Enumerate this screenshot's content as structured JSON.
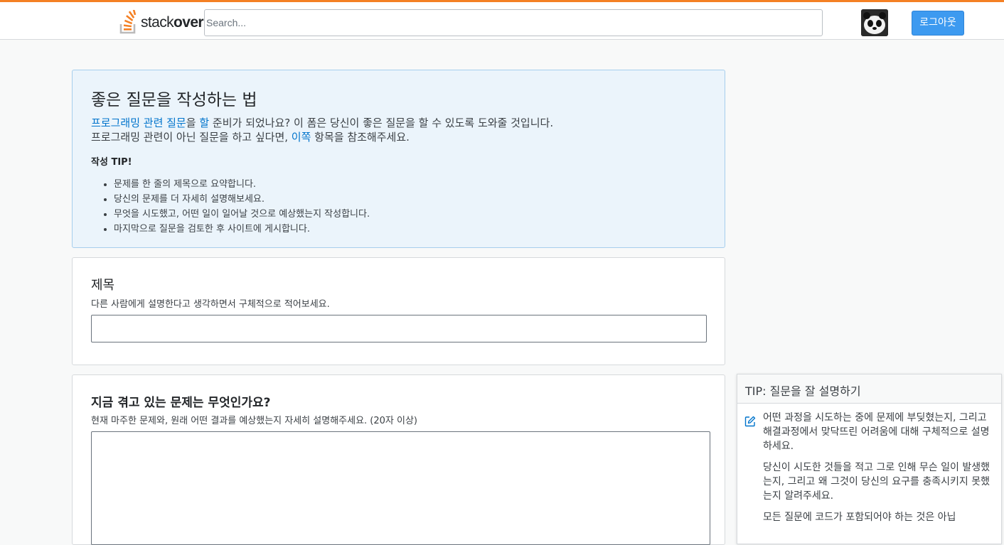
{
  "colors": {
    "accent": "#f48024",
    "link": "#0074cc",
    "button": "#3d9af0",
    "guide_bg": "#ebf4fb"
  },
  "header": {
    "logo_text_regular": "stack",
    "logo_text_bold": "over",
    "search_placeholder": "Search...",
    "avatar_icon": "panda-avatar",
    "logout_label": "로그아웃"
  },
  "guide": {
    "title": "좋은 질문을 작성하는 법",
    "line1_link1": "프로그래밍 관련 질문",
    "line1_mid": "을 ",
    "line1_link2": "할",
    "line1_rest": " 준비가 되었나요? 이 폼은 당신이 좋은 질문을 할 수 있도록 도와줄 것입니다.",
    "line2_before": "프로그래밍 관련이 아닌 질문을 하고 싶다면, ",
    "line2_link": "이쪽",
    "line2_after": " 항목을 참조해주세요.",
    "tip_label": "작성 TIP!",
    "tips": [
      "문제를 한 줄의 제목으로 요약합니다.",
      "당신의 문제를 더 자세히 설명해보세요.",
      "무엇을 시도했고, 어떤 일이 일어날 것으로 예상했는지 작성합니다.",
      "마지막으로 질문을 검토한 후 사이트에 게시합니다."
    ]
  },
  "title_section": {
    "heading": "제목",
    "hint": "다른 사람에게 설명한다고 생각하면서 구체적으로 적어보세요.",
    "value": ""
  },
  "body_section": {
    "heading": "지금 겪고 있는 문제는 무엇인가요?",
    "hint": "현재 마주한 문제와, 원래 어떤 결과를 예상했는지 자세히 설명해주세요. (20자 이상)",
    "value": ""
  },
  "side_tip": {
    "title": "TIP: 질문을 잘 설명하기",
    "icon": "edit-icon",
    "paragraphs": [
      "어떤 과정을 시도하는 중에 문제에 부딪혔는지, 그리고 해결과정에서 맞닥뜨린 어려움에 대해 구체적으로 설명하세요.",
      "당신이 시도한 것들을 적고 그로 인해 무슨 일이 발생했는지, 그리고 왜 그것이 당신의 요구를 충족시키지 못했는지 알려주세요.",
      "모든 질문에 코드가 포함되어야 하는 것은 아닙"
    ]
  }
}
